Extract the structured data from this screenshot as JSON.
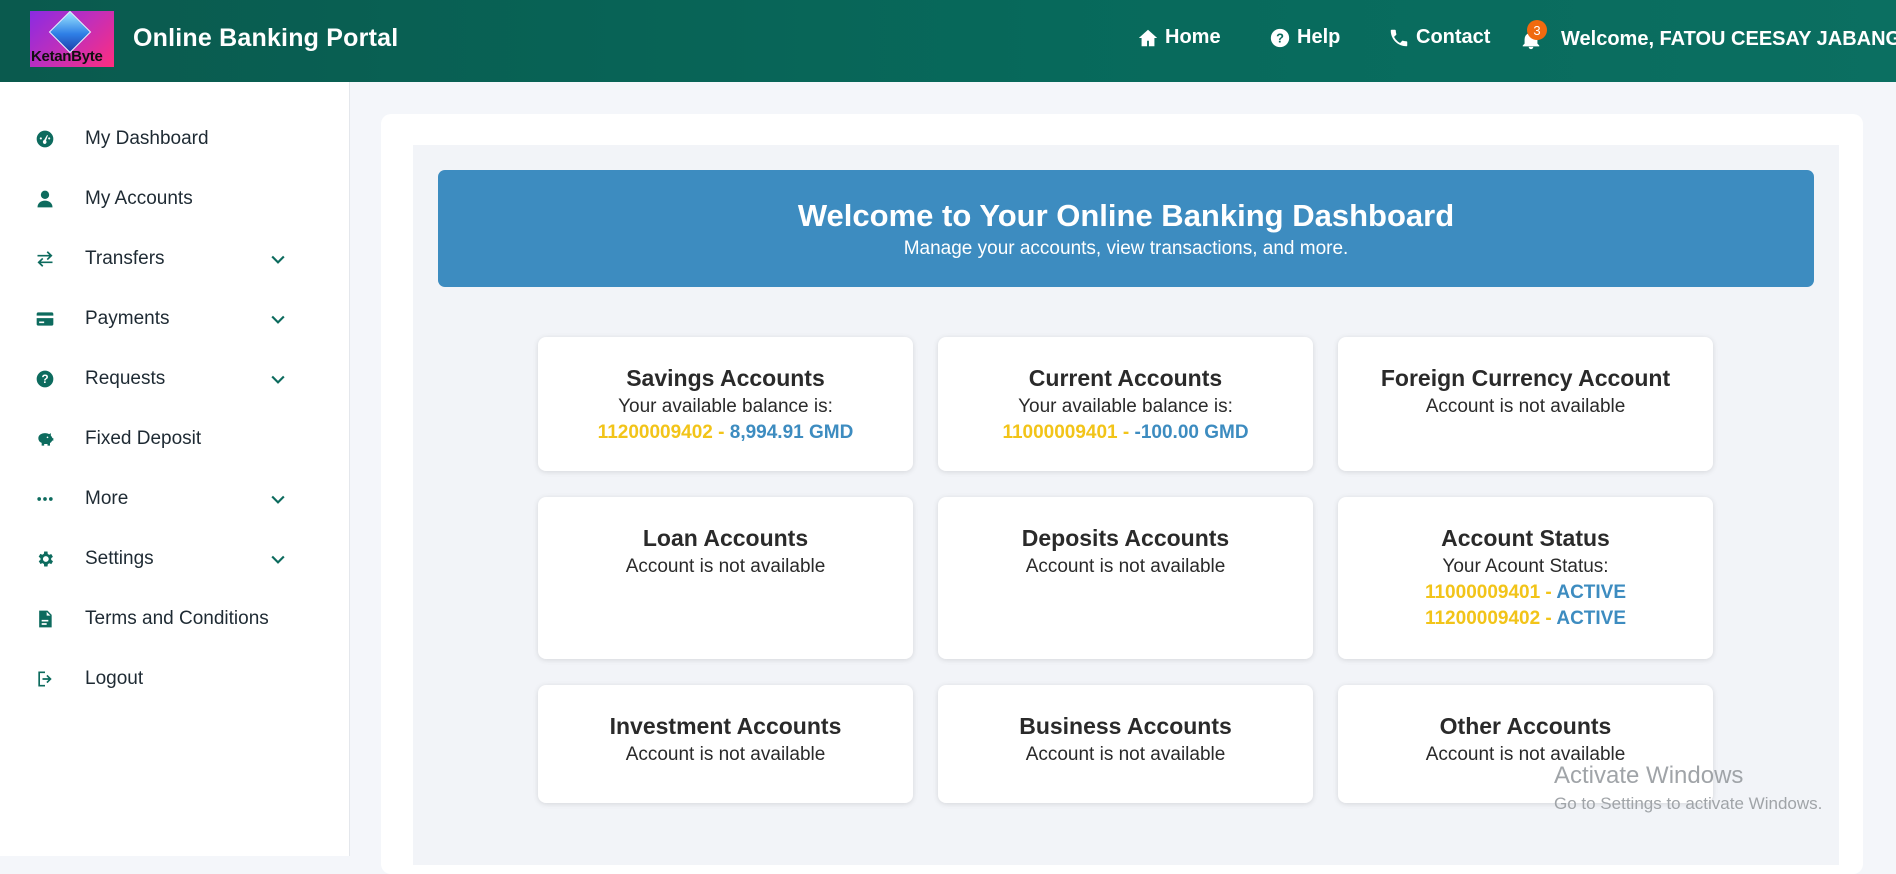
{
  "header": {
    "logo_text": "KetanByte",
    "title": "Online Banking Portal",
    "nav": [
      {
        "label": "Home",
        "icon": "home-icon"
      },
      {
        "label": "Help",
        "icon": "question-circle-icon"
      },
      {
        "label": "Contact",
        "icon": "phone-icon"
      }
    ],
    "notification_count": "3",
    "welcome": "Welcome, FATOU CEESAY JABANG"
  },
  "sidebar": {
    "items": [
      {
        "label": "My Dashboard",
        "icon": "dashboard-icon",
        "expandable": false
      },
      {
        "label": "My Accounts",
        "icon": "user-icon",
        "expandable": false
      },
      {
        "label": "Transfers",
        "icon": "exchange-icon",
        "expandable": true
      },
      {
        "label": "Payments",
        "icon": "credit-card-icon",
        "expandable": true
      },
      {
        "label": "Requests",
        "icon": "question-circle-icon",
        "expandable": true
      },
      {
        "label": "Fixed Deposit",
        "icon": "piggy-bank-icon",
        "expandable": false
      },
      {
        "label": "More",
        "icon": "ellipsis-icon",
        "expandable": true
      },
      {
        "label": "Settings",
        "icon": "gear-icon",
        "expandable": true
      },
      {
        "label": "Terms and Conditions",
        "icon": "document-icon",
        "expandable": false
      },
      {
        "label": "Logout",
        "icon": "logout-icon",
        "expandable": false
      }
    ]
  },
  "hero": {
    "title": "Welcome to Your Online Banking Dashboard",
    "subtitle": "Manage your accounts, view transactions, and more."
  },
  "cards": {
    "savings": {
      "title": "Savings Accounts",
      "subtitle": "Your available balance is:",
      "account": "11200009402",
      "sep": " - ",
      "balance": "8,994.91 GMD"
    },
    "current": {
      "title": "Current Accounts",
      "subtitle": "Your available balance is:",
      "account": "11000009401",
      "sep": " - ",
      "balance": "-100.00 GMD"
    },
    "foreign": {
      "title": "Foreign Currency Account",
      "subtitle": "Account is not available"
    },
    "loan": {
      "title": "Loan Accounts",
      "subtitle": "Account is not available"
    },
    "deposits": {
      "title": "Deposits Accounts",
      "subtitle": "Account is not available"
    },
    "status": {
      "title": "Account Status",
      "subtitle": "Your Acount Status:",
      "lines": [
        {
          "account": "11000009401",
          "sep": " - ",
          "status": "ACTIVE"
        },
        {
          "account": "11200009402",
          "sep": " - ",
          "status": "ACTIVE"
        }
      ]
    },
    "investment": {
      "title": "Investment Accounts",
      "subtitle": "Account is not available"
    },
    "business": {
      "title": "Business Accounts",
      "subtitle": "Account is not available"
    },
    "other": {
      "title": "Other Accounts",
      "subtitle": "Account is not available"
    }
  },
  "watermark": {
    "line1": "Activate Windows",
    "line2": "Go to Settings to activate Windows."
  },
  "colors": {
    "header_bg": "#07695b",
    "accent_blue": "#3d8cc0",
    "account_yellow": "#f2c419",
    "badge_orange": "#f06a0f"
  }
}
